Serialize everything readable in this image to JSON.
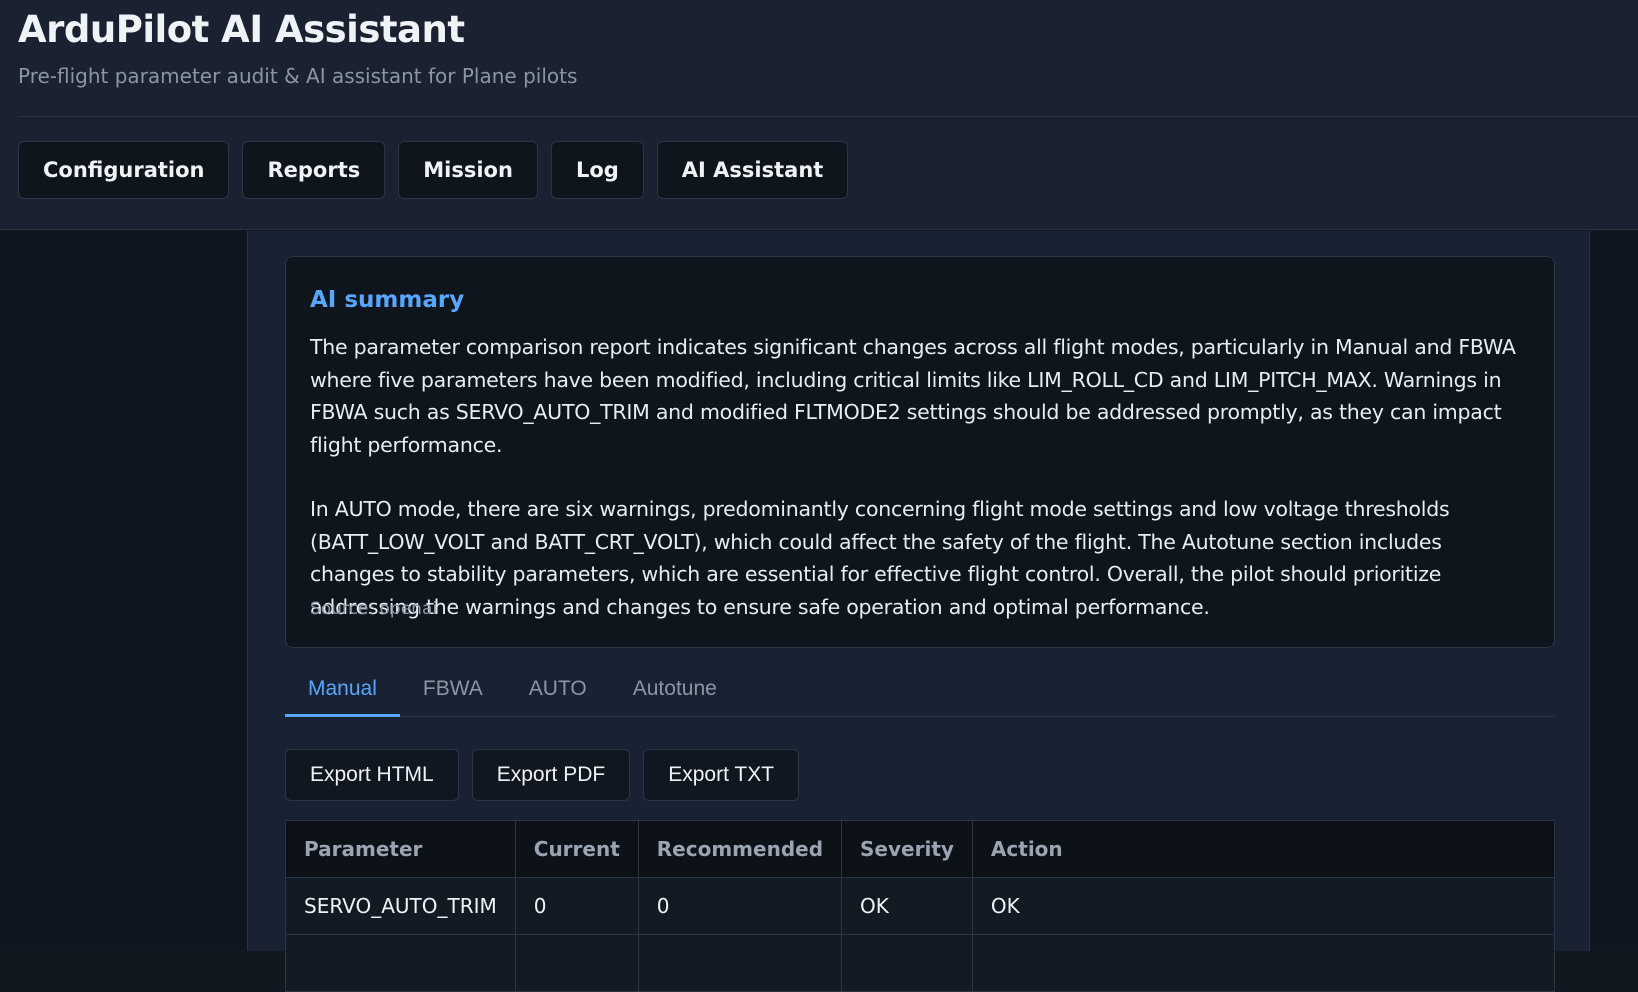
{
  "app": {
    "title": "ArduPilot AI Assistant",
    "subtitle": "Pre-flight parameter audit & AI assistant for Plane pilots"
  },
  "nav": {
    "items": [
      {
        "label": "Configuration"
      },
      {
        "label": "Reports"
      },
      {
        "label": "Mission"
      },
      {
        "label": "Log"
      },
      {
        "label": "AI Assistant"
      }
    ]
  },
  "summary": {
    "title": "AI summary",
    "paragraph1": "The parameter comparison report indicates significant changes across all flight modes, particularly in Manual and FBWA where five parameters have been modified, including critical limits like LIM_ROLL_CD and LIM_PITCH_MAX. Warnings in FBWA such as SERVO_AUTO_TRIM and modified FLTMODE2 settings should be addressed promptly, as they can impact flight performance.",
    "paragraph2": "In AUTO mode, there are six warnings, predominantly concerning flight mode settings and low voltage thresholds (BATT_LOW_VOLT and BATT_CRT_VOLT), which could affect the safety of the flight. The Autotune section includes changes to stability parameters, which are essential for effective flight control. Overall, the pilot should prioritize addressing the warnings and changes to ensure safe operation and optimal performance.",
    "source": "Source: openai"
  },
  "tabs": {
    "active": "Manual",
    "items": [
      {
        "label": "Manual"
      },
      {
        "label": "FBWA"
      },
      {
        "label": "AUTO"
      },
      {
        "label": "Autotune"
      }
    ]
  },
  "exports": {
    "html": "Export HTML",
    "pdf": "Export PDF",
    "txt": "Export TXT"
  },
  "table": {
    "headers": [
      "Parameter",
      "Current",
      "Recommended",
      "Severity",
      "Action"
    ],
    "rows": [
      {
        "parameter": "SERVO_AUTO_TRIM",
        "current": "0",
        "recommended": "0",
        "severity": "OK",
        "action": "OK"
      }
    ]
  },
  "colors": {
    "accent": "#58a6ff",
    "severity_ok": "#3fb950"
  }
}
